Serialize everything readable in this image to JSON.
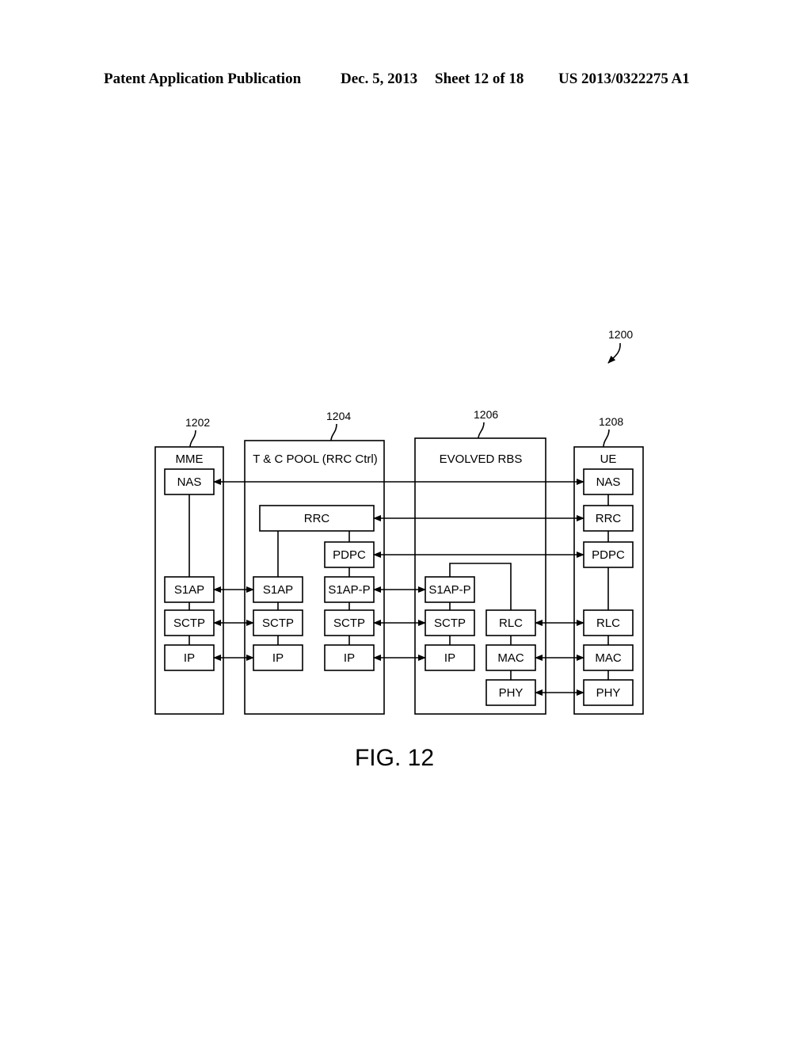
{
  "header": {
    "publication": "Patent Application Publication",
    "date": "Dec. 5, 2013",
    "sheet": "Sheet 12 of 18",
    "number": "US 2013/0322275 A1"
  },
  "figure": {
    "ref": "1200",
    "caption": "FIG. 12"
  },
  "entities": {
    "mme": {
      "ref": "1202",
      "title": "MME",
      "layers": [
        "NAS",
        "S1AP",
        "SCTP",
        "IP"
      ]
    },
    "pool": {
      "ref": "1204",
      "title": "T & C POOL (RRC Ctrl)",
      "rrc": "RRC",
      "stack_a": [
        "S1AP",
        "SCTP",
        "IP"
      ],
      "stack_b": [
        "PDPC",
        "S1AP-P",
        "SCTP",
        "IP"
      ]
    },
    "rbs": {
      "ref": "1206",
      "title": "EVOLVED RBS",
      "stack_a": [
        "S1AP-P",
        "SCTP",
        "IP"
      ],
      "stack_b": [
        "RLC",
        "MAC",
        "PHY"
      ]
    },
    "ue": {
      "ref": "1208",
      "title": "UE",
      "layers": [
        "NAS",
        "RRC",
        "PDPC",
        "RLC",
        "MAC",
        "PHY"
      ]
    }
  },
  "connections": [
    {
      "from": "MME.NAS",
      "to": "UE.NAS"
    },
    {
      "from": "POOL.RRC",
      "to": "UE.RRC"
    },
    {
      "from": "POOL.PDPC",
      "to": "UE.PDPC"
    },
    {
      "from": "MME.S1AP",
      "to": "POOL.S1AP"
    },
    {
      "from": "MME.SCTP",
      "to": "POOL.SCTP"
    },
    {
      "from": "MME.IP",
      "to": "POOL.IP"
    },
    {
      "from": "POOL.S1AP-P",
      "to": "RBS.S1AP-P"
    },
    {
      "from": "POOL.SCTP",
      "to": "RBS.SCTP"
    },
    {
      "from": "POOL.IP",
      "to": "RBS.IP"
    },
    {
      "from": "RBS.RLC",
      "to": "UE.RLC"
    },
    {
      "from": "RBS.MAC",
      "to": "UE.MAC"
    },
    {
      "from": "RBS.PHY",
      "to": "UE.PHY"
    }
  ]
}
